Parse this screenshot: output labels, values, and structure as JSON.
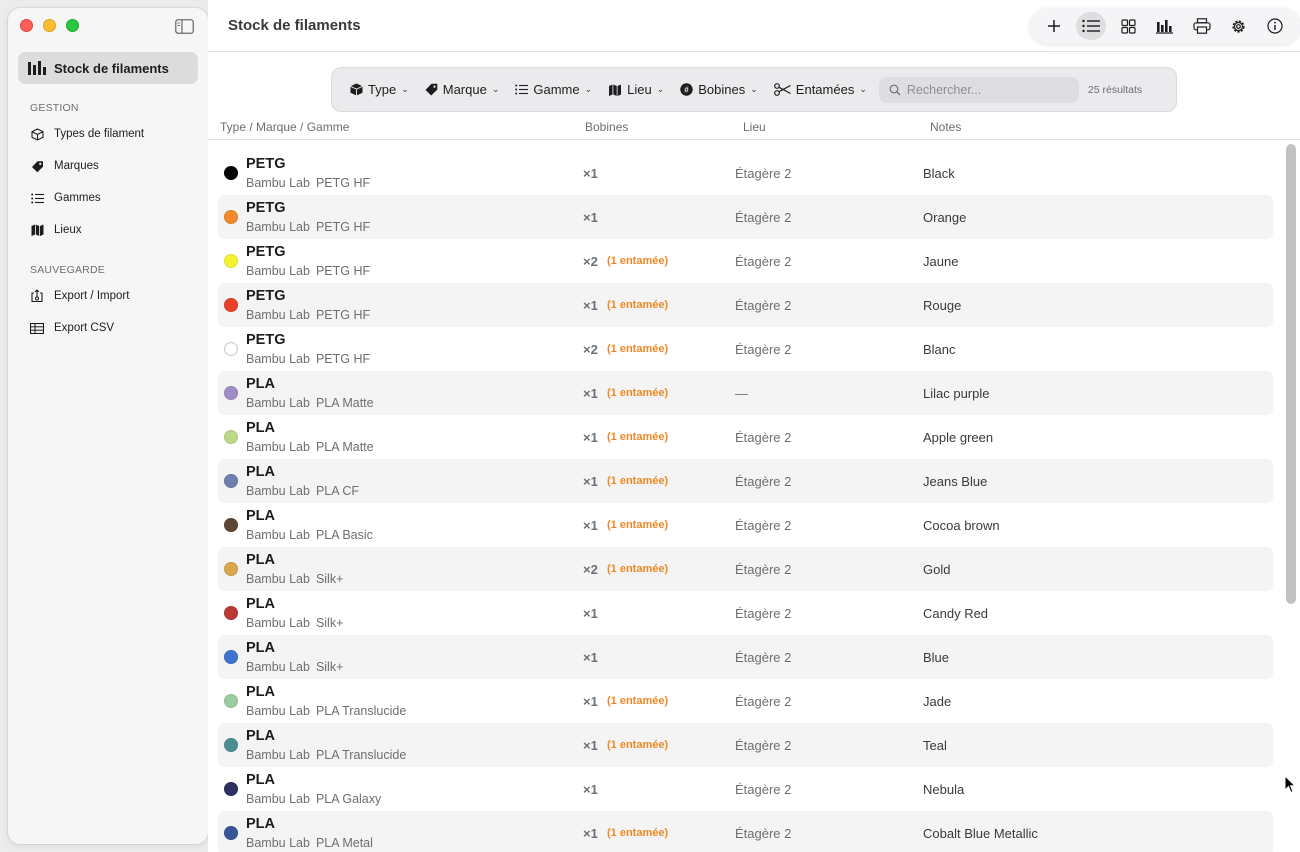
{
  "sidebar": {
    "active_item": "Stock de filaments",
    "sections": [
      {
        "title": "GESTION",
        "items": [
          "Types de filament",
          "Marques",
          "Gammes",
          "Lieux"
        ]
      },
      {
        "title": "SAUVEGARDE",
        "items": [
          "Export / Import",
          "Export CSV"
        ]
      }
    ]
  },
  "header": {
    "title": "Stock de filaments"
  },
  "filters": {
    "type": "Type",
    "brand": "Marque",
    "range": "Gamme",
    "location": "Lieu",
    "spools": "Bobines",
    "started": "Entamées",
    "search_placeholder": "Rechercher...",
    "results": "25 résultats"
  },
  "table": {
    "columns": [
      "Type / Marque / Gamme",
      "Bobines",
      "Lieu",
      "Notes"
    ],
    "rows": [
      {
        "type": "PETG",
        "brand": "Bambu Lab",
        "range": "PETG HF",
        "count": "×1",
        "started": "",
        "location": "Étagère 2",
        "note": "Black",
        "color": "#050505"
      },
      {
        "type": "PETG",
        "brand": "Bambu Lab",
        "range": "PETG HF",
        "count": "×1",
        "started": "",
        "location": "Étagère 2",
        "note": "Orange",
        "color": "#f18a2c"
      },
      {
        "type": "PETG",
        "brand": "Bambu Lab",
        "range": "PETG HF",
        "count": "×2",
        "started": "(1 entamée)",
        "location": "Étagère 2",
        "note": "Jaune",
        "color": "#f5f234"
      },
      {
        "type": "PETG",
        "brand": "Bambu Lab",
        "range": "PETG HF",
        "count": "×1",
        "started": "(1 entamée)",
        "location": "Étagère 2",
        "note": "Rouge",
        "color": "#e8412a"
      },
      {
        "type": "PETG",
        "brand": "Bambu Lab",
        "range": "PETG HF",
        "count": "×2",
        "started": "(1 entamée)",
        "location": "Étagère 2",
        "note": "Blanc",
        "color": "#ffffff"
      },
      {
        "type": "PLA",
        "brand": "Bambu Lab",
        "range": "PLA Matte",
        "count": "×1",
        "started": "(1 entamée)",
        "location": "—",
        "note": "Lilac purple",
        "color": "#a08cc8"
      },
      {
        "type": "PLA",
        "brand": "Bambu Lab",
        "range": "PLA Matte",
        "count": "×1",
        "started": "(1 entamée)",
        "location": "Étagère 2",
        "note": "Apple green",
        "color": "#bcd98a"
      },
      {
        "type": "PLA",
        "brand": "Bambu Lab",
        "range": "PLA CF",
        "count": "×1",
        "started": "(1 entamée)",
        "location": "Étagère 2",
        "note": "Jeans Blue",
        "color": "#6f7fb0"
      },
      {
        "type": "PLA",
        "brand": "Bambu Lab",
        "range": "PLA Basic",
        "count": "×1",
        "started": "(1 entamée)",
        "location": "Étagère 2",
        "note": "Cocoa brown",
        "color": "#5e4636"
      },
      {
        "type": "PLA",
        "brand": "Bambu Lab",
        "range": "Silk+",
        "count": "×2",
        "started": "(1 entamée)",
        "location": "Étagère 2",
        "note": "Gold",
        "color": "#dba74e"
      },
      {
        "type": "PLA",
        "brand": "Bambu Lab",
        "range": "Silk+",
        "count": "×1",
        "started": "",
        "location": "Étagère 2",
        "note": "Candy Red",
        "color": "#b83a33"
      },
      {
        "type": "PLA",
        "brand": "Bambu Lab",
        "range": "Silk+",
        "count": "×1",
        "started": "",
        "location": "Étagère 2",
        "note": "Blue",
        "color": "#3f73cf"
      },
      {
        "type": "PLA",
        "brand": "Bambu Lab",
        "range": "PLA Translucide",
        "count": "×1",
        "started": "(1 entamée)",
        "location": "Étagère 2",
        "note": "Jade",
        "color": "#9ccc9f"
      },
      {
        "type": "PLA",
        "brand": "Bambu Lab",
        "range": "PLA Translucide",
        "count": "×1",
        "started": "(1 entamée)",
        "location": "Étagère 2",
        "note": "Teal",
        "color": "#4b8e92"
      },
      {
        "type": "PLA",
        "brand": "Bambu Lab",
        "range": "PLA Galaxy",
        "count": "×1",
        "started": "",
        "location": "Étagère 2",
        "note": "Nebula",
        "color": "#2e2f63"
      },
      {
        "type": "PLA",
        "brand": "Bambu Lab",
        "range": "PLA Metal",
        "count": "×1",
        "started": "(1 entamée)",
        "location": "Étagère 2",
        "note": "Cobalt Blue Metallic",
        "color": "#3a5696"
      }
    ]
  },
  "colors": {
    "accent_started": "#ef8a23",
    "active_nav": "#dcdcdc"
  }
}
